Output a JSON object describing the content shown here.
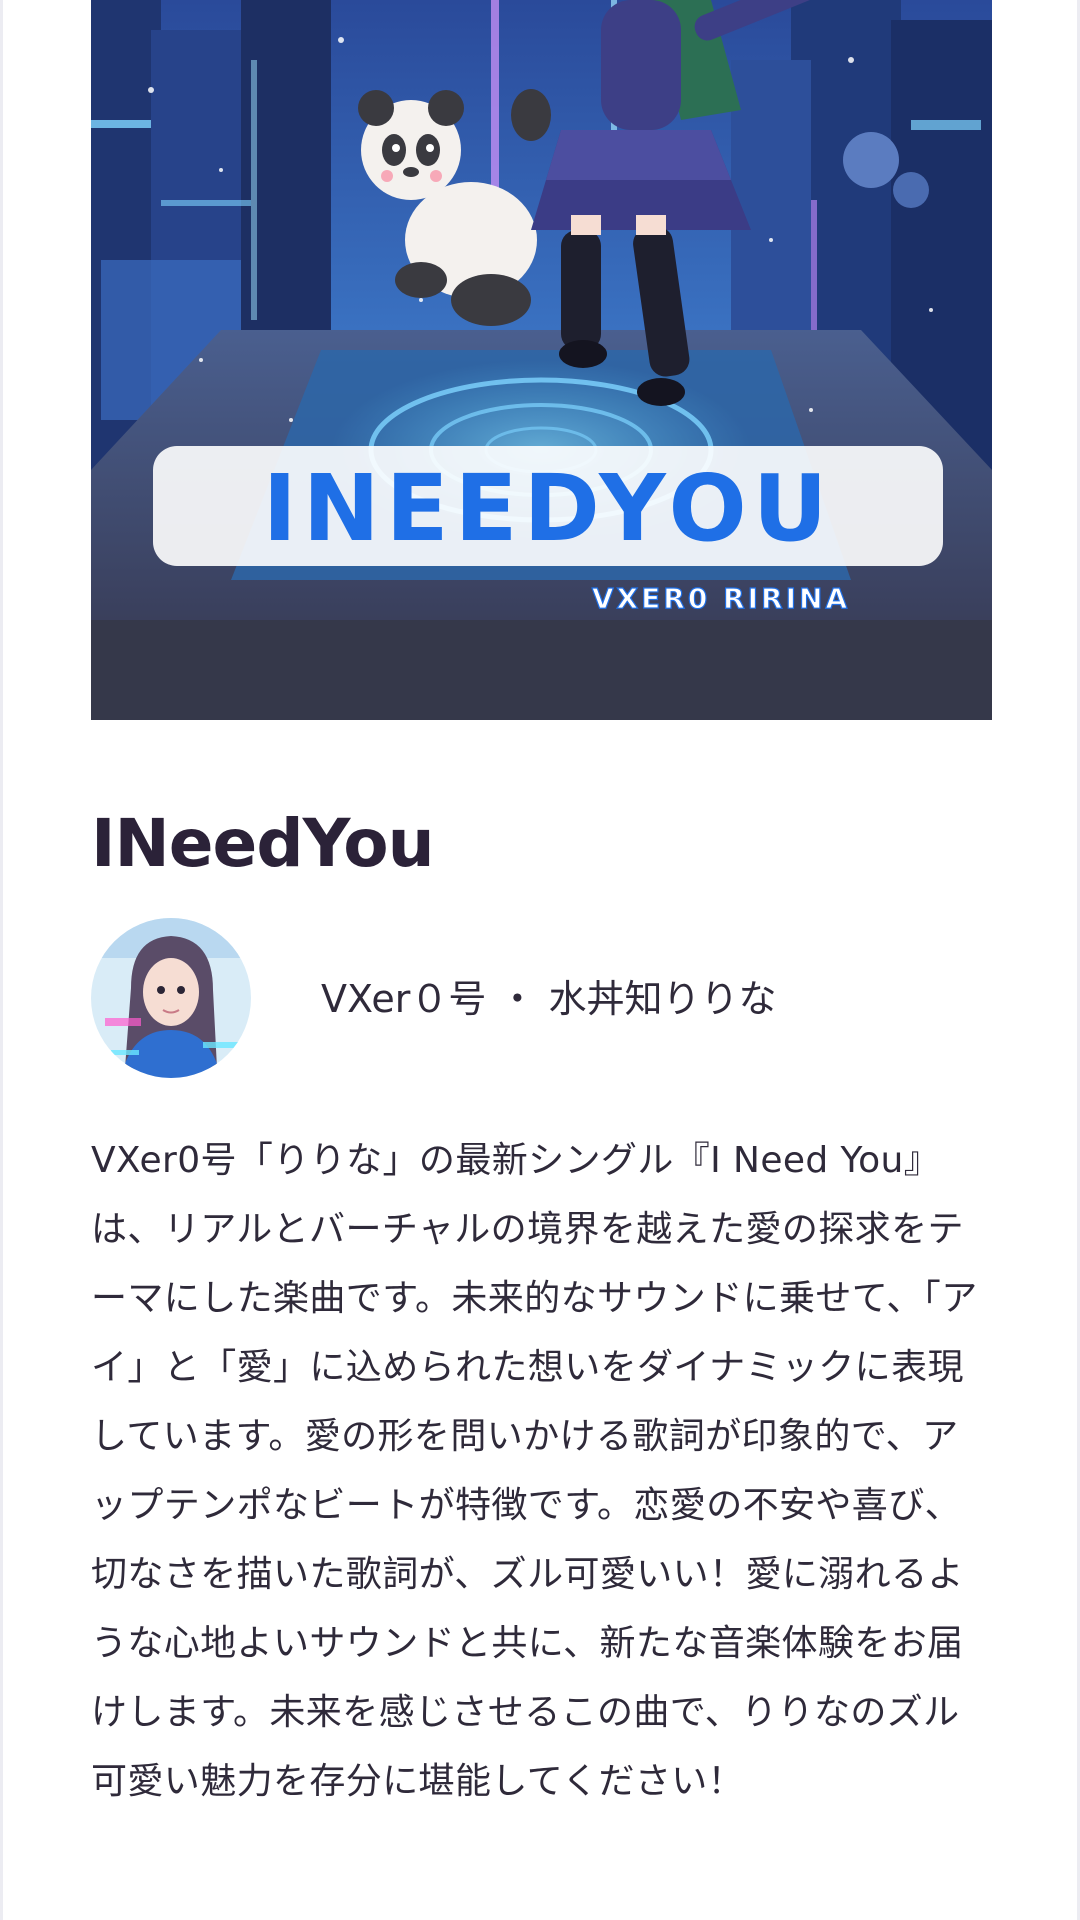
{
  "cover": {
    "logo_text": "INEEDYOU",
    "logo_subtext": "VXER0 RIRINA",
    "colors": {
      "sky_top": "#2a4a9a",
      "sky_bottom": "#3d79c9",
      "neon": "#5fd2ff",
      "logo_blue": "#1f6fe6",
      "floor": "#3a3a4e"
    }
  },
  "song": {
    "title": "INeedYou"
  },
  "artist": {
    "avatar_icon": "artist-avatar",
    "name": "VXer０号 ・ 水丼知りりな"
  },
  "description": {
    "text": "VXer0号「りりな」の最新シングル『I Need You』は、リアルとバーチャルの境界を越えた愛の探求をテーマにした楽曲です。未来的なサウンドに乗せて、「アイ」と「愛」に込められた想いをダイナミックに表現しています。愛の形を問いかける歌詞が印象的で、アップテンポなビートが特徴です。恋愛の不安や喜び、切なさを描いた歌詞が、ズル可愛いい！愛に溺れるような心地よいサウンドと共に、新たな音楽体験をお届けします。未来を感じさせるこの曲で、りりなのズル可愛い魅力を存分に堪能してください！"
  }
}
